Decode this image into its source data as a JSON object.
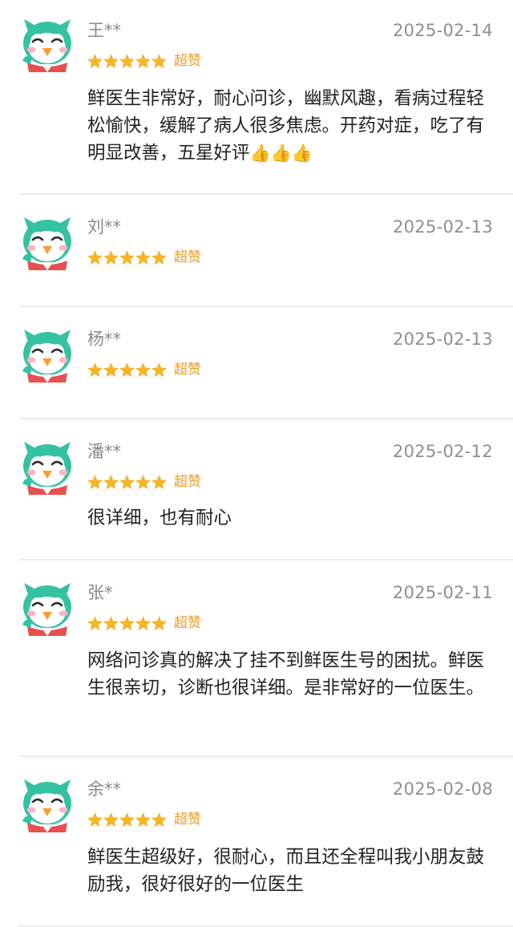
{
  "reviews": [
    {
      "name": "王**",
      "date": "2025-02-14",
      "rating": "超赞",
      "stars": 5,
      "content": "鲜医生非常好，耐心问诊，幽默风趣，看病过程轻松愉快，缓解了病人很多焦虑。开药对症，吃了有明显改善，五星好评",
      "emoji": "👍👍👍"
    },
    {
      "name": "刘**",
      "date": "2025-02-13",
      "rating": "超赞",
      "stars": 5,
      "content": "",
      "emoji": ""
    },
    {
      "name": "杨**",
      "date": "2025-02-13",
      "rating": "超赞",
      "stars": 5,
      "content": "",
      "emoji": ""
    },
    {
      "name": "潘**",
      "date": "2025-02-12",
      "rating": "超赞",
      "stars": 5,
      "content": "很详细，也有耐心",
      "emoji": ""
    },
    {
      "name": "张*",
      "date": "2025-02-11",
      "rating": "超赞",
      "stars": 5,
      "content": "网络问诊真的解决了挂不到鲜医生号的困扰。鲜医生很亲切，诊断也很详细。是非常好的一位医生。",
      "emoji": ""
    },
    {
      "name": "余**",
      "date": "2025-02-08",
      "rating": "超赞",
      "stars": 5,
      "content": "鲜医生超级好，很耐心，而且还全程叫我小朋友鼓励我，很好很好的一位医生",
      "emoji": ""
    }
  ],
  "colors": {
    "star": "#f7b526",
    "rating_text": "#f39a1e",
    "avatar_green": "#35c2a3",
    "avatar_beak": "#ff9b2e"
  },
  "icons": {
    "avatar": "green-bird-mascot-icon",
    "star": "star-icon",
    "emoji": "thumbs-up-emoji"
  }
}
